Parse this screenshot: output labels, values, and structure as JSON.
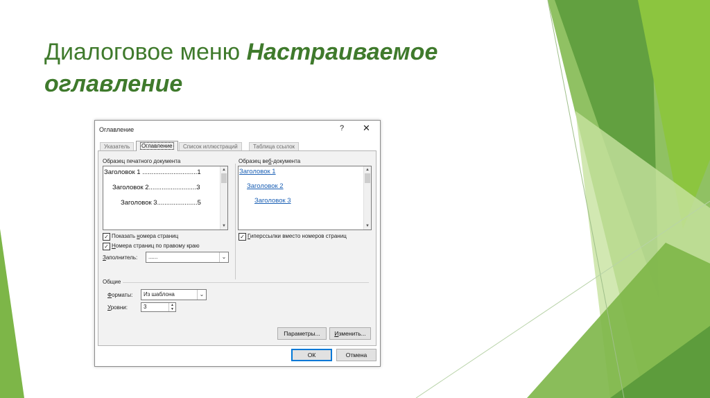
{
  "slide": {
    "title_plain": "Диалоговое меню ",
    "title_emph": "Настраиваемое оглавление",
    "colors": {
      "title": "#3f7a2c",
      "green_dark": "#5d9c3c",
      "green_mid": "#7db648",
      "green_light": "#c7e29f"
    }
  },
  "dialog": {
    "title": "Оглавление",
    "help_glyph": "?",
    "close_glyph": "✕",
    "tabs": [
      {
        "label": "Указатель"
      },
      {
        "label": "Оглавление",
        "active": true
      },
      {
        "label": "Список иллюстраций"
      },
      {
        "label": "Таблица ссылок"
      }
    ],
    "print_preview": {
      "label": "Образец печатного документа",
      "lines": [
        "Заголовок 1 ..............................1",
        "Заголовок 2..........................3",
        "Заголовок 3......................5"
      ]
    },
    "web_preview": {
      "label_before": "Образец ве",
      "label_hot": "б",
      "label_after": "-документа",
      "lines": [
        "Заголовок 1",
        "Заголовок 2",
        "Заголовок 3"
      ]
    },
    "show_page_numbers": {
      "before": "Показать ",
      "hot": "н",
      "after": "омера страниц",
      "checked": true
    },
    "right_align_numbers": {
      "before": "",
      "hot": "Н",
      "after": "омера страниц по правому краю",
      "checked": true
    },
    "hyperlinks": {
      "before": "",
      "hot": "Г",
      "after": "иперссылки вместо номеров страниц",
      "checked": true
    },
    "leader": {
      "label_hot": "З",
      "label_rest": "аполнитель:",
      "value": "......"
    },
    "general": {
      "title": "Общие",
      "formats_label_hot": "Ф",
      "formats_label_rest": "орматы:",
      "formats_value": "Из шаблона",
      "levels_label_hot": "У",
      "levels_label_rest": "ровни:",
      "levels_value": "3"
    },
    "buttons": {
      "params": "Параметры...",
      "modify_hot": "И",
      "modify_rest": "зменить...",
      "ok": "ОК",
      "cancel": "Отмена"
    }
  }
}
